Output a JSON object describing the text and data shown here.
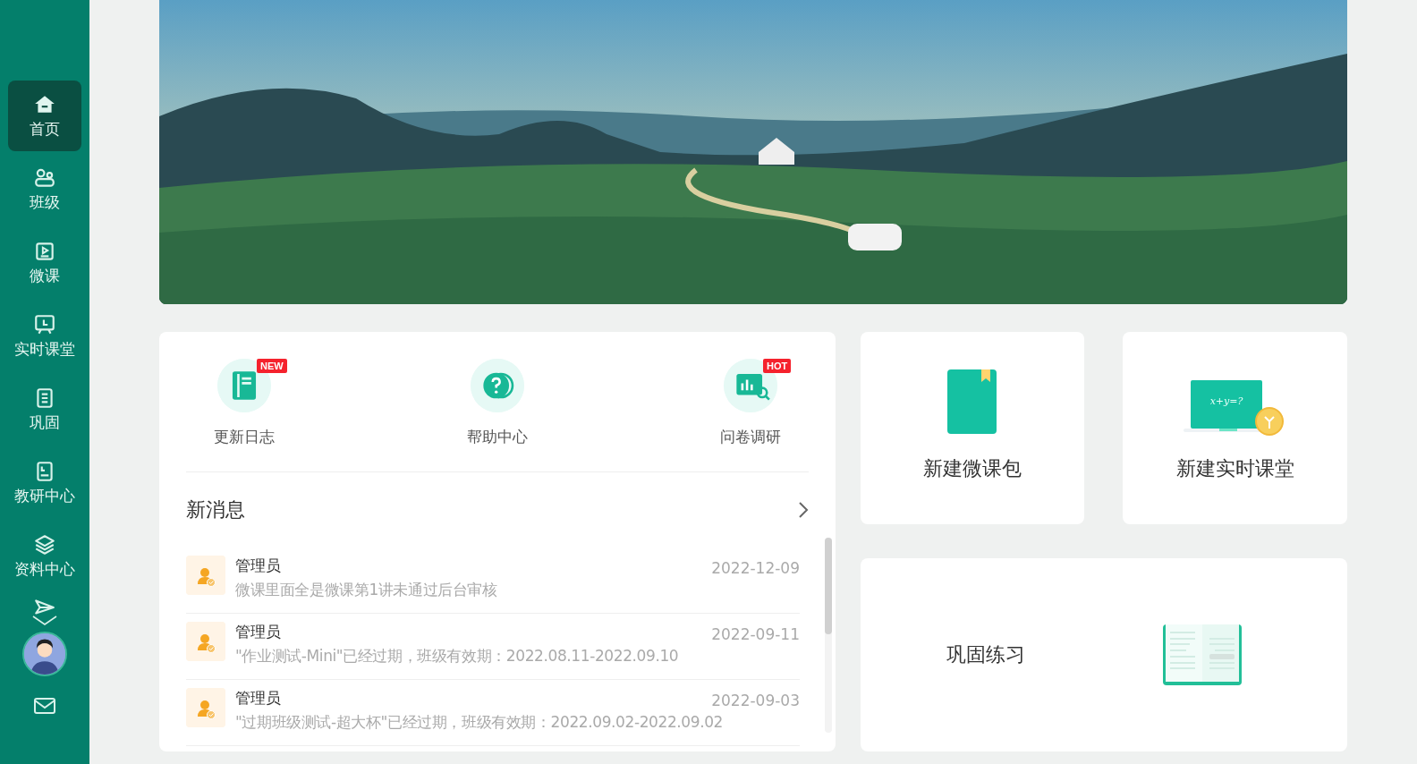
{
  "sidebar": {
    "items": [
      {
        "label": "首页",
        "selected": true
      },
      {
        "label": "班级",
        "selected": false
      },
      {
        "label": "微课",
        "selected": false
      },
      {
        "label": "实时课堂",
        "selected": false
      },
      {
        "label": "巩固",
        "selected": false
      },
      {
        "label": "教研中心",
        "selected": false
      },
      {
        "label": "资料中心",
        "selected": false
      }
    ]
  },
  "quick_links": [
    {
      "label": "更新日志",
      "badge": "NEW"
    },
    {
      "label": "帮助中心"
    },
    {
      "label": "问卷调研",
      "badge": "HOT"
    }
  ],
  "messages": {
    "title": "新消息",
    "items": [
      {
        "sender": "管理员",
        "text": "微课里面全是微课第1讲未通过后台审核",
        "date": "2022-12-09"
      },
      {
        "sender": "管理员",
        "text": "\"作业测试-Mini\"已经过期，班级有效期：2022.08.11-2022.09.10",
        "date": "2022-09-11"
      },
      {
        "sender": "管理员",
        "text": "\"过期班级测试-超大杯\"已经过期，班级有效期：2022.09.02-2022.09.02",
        "date": "2022-09-03"
      }
    ]
  },
  "actions": [
    {
      "kind": "book",
      "label": "新建微课包"
    },
    {
      "kind": "board",
      "label": "新建实时课堂",
      "board_text": "x+y=?"
    },
    {
      "kind": "open-book",
      "label": "巩固练习"
    }
  ]
}
